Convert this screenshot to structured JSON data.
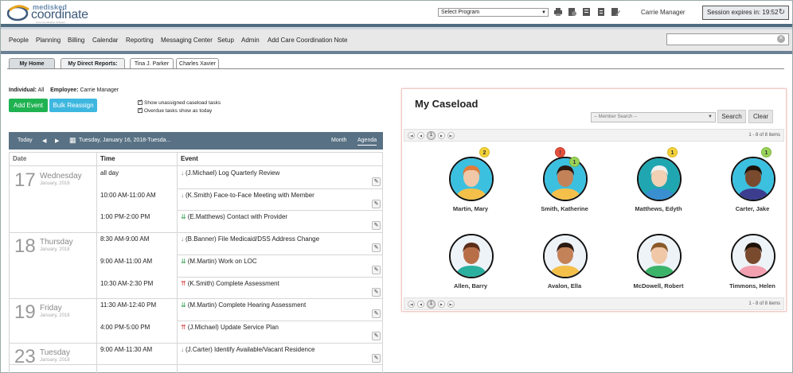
{
  "header": {
    "logo_top": "medisked",
    "logo_main": "coordinate",
    "logo_tagline": "Care Coordination Software",
    "program_select": "Select Program",
    "icons": [
      "print-icon",
      "print-preview-icon",
      "list-icon",
      "document-icon",
      "edit-document-icon"
    ],
    "user": "Carrie Manager",
    "session": "Session expires in: 19:52"
  },
  "nav": {
    "items": [
      "People",
      "Planning",
      "Billing",
      "Calendar",
      "Reporting",
      "Messaging Center",
      "Setup",
      "Admin",
      "Add Care Coordination Note"
    ],
    "search_placeholder": ""
  },
  "tabs": {
    "home": "My Home",
    "reports": "My Direct Reports:",
    "people": [
      "Tina J. Parker",
      "Charles Xavier"
    ]
  },
  "filters": {
    "individual_label": "Individual:",
    "individual_value": "All",
    "employee_label": "Employee:",
    "employee_value": "Carrie Manager",
    "add_event": "Add Event",
    "bulk_reassign": "Bulk Reassign",
    "show_unassigned": "Show unassigned caseload tasks",
    "overdue_today": "Overdue tasks show as today"
  },
  "calendar": {
    "today": "Today",
    "date_label": "Tuesday, January 16, 2018-Tuesda...",
    "view_month": "Month",
    "view_agenda": "Agenda",
    "headers": [
      "Date",
      "Time",
      "Event"
    ],
    "days": [
      {
        "num": "17",
        "day": "Wednesday",
        "month": "January, 2018",
        "events": [
          {
            "time": "all day",
            "arrow": "↓",
            "arrow_class": "arr-grey",
            "text": "(J.Michael) Log Quarterly Review"
          },
          {
            "time": "10:00 AM-11:00 AM",
            "arrow": "↓",
            "arrow_class": "arr-grey",
            "text": "(K.Smith) Face-to-Face Meeting with Member"
          },
          {
            "time": "1:00 PM-2:00 PM",
            "arrow": "⇊",
            "arrow_class": "arr-green",
            "text": "(E.Matthews) Contact with Provider"
          }
        ]
      },
      {
        "num": "18",
        "day": "Thursday",
        "month": "January, 2018",
        "events": [
          {
            "time": "8:30 AM-9:00 AM",
            "arrow": "↓",
            "arrow_class": "arr-grey",
            "text": "(B.Banner) File Medicaid/DSS Address Change"
          },
          {
            "time": "9:00 AM-11:00 AM",
            "arrow": "⇊",
            "arrow_class": "arr-green",
            "text": "(M.Martin) Work on LOC"
          },
          {
            "time": "10:30 AM-2:30 PM",
            "arrow": "⇈",
            "arrow_class": "arr-red",
            "text": "(K.Smith) Complete Assessment"
          }
        ]
      },
      {
        "num": "19",
        "day": "Friday",
        "month": "January, 2018",
        "events": [
          {
            "time": "11:30 AM-12:40 PM",
            "arrow": "⇊",
            "arrow_class": "arr-green",
            "text": "(M.Martin) Complete Hearing Assessment"
          },
          {
            "time": "4:00 PM-5:00 PM",
            "arrow": "⇈",
            "arrow_class": "arr-red",
            "text": "(J.Michael) Update Service Plan"
          }
        ]
      },
      {
        "num": "23",
        "day": "Tuesday",
        "month": "January, 2018",
        "events": [
          {
            "time": "9:00 AM-11:30 AM",
            "arrow": "↓",
            "arrow_class": "arr-grey",
            "text": "(J.Carter) Identify Available/Vacant Residence"
          }
        ]
      }
    ]
  },
  "caseload": {
    "title": "My Caseload",
    "member_search": "-- Member Search --",
    "search": "Search",
    "clear": "Clear",
    "page": "1",
    "page_info": "1 - 8 of 8 items",
    "members": [
      {
        "name": "Martin, Mary",
        "skin": "#f0c8a8",
        "hair": "#e07b3a",
        "bg": "#3cc0e0",
        "shirt": "#f4c04a"
      },
      {
        "name": "Smith, Katherine",
        "skin": "#c48258",
        "hair": "#2b1a12",
        "bg": "#3cc0e0",
        "shirt": "#f4c04a"
      },
      {
        "name": "Matthews, Edyth",
        "skin": "#f2d0b4",
        "hair": "#f0f0f0",
        "bg": "#20a6b0",
        "shirt": "#3a8fd0"
      },
      {
        "name": "Carter, Jake",
        "skin": "#7a4a2e",
        "hair": "#1d1208",
        "bg": "#3cc0e0",
        "shirt": "#3d3d8f"
      },
      {
        "name": "Allen, Barry",
        "skin": "#b86f48",
        "hair": "#5a2e18",
        "bg": "#eef3f8",
        "shirt": "#2bb0a0"
      },
      {
        "name": "Avalon, Ella",
        "skin": "#c48258",
        "hair": "#2b1a12",
        "bg": "#eef3f8",
        "shirt": "#f4c04a"
      },
      {
        "name": "McDowell, Robert",
        "skin": "#f0c8a8",
        "hair": "#8a5a2a",
        "bg": "#eef3f8",
        "shirt": "#3bb46a"
      },
      {
        "name": "Timmons, Helen",
        "skin": "#7a4a2e",
        "hair": "#1d1208",
        "bg": "#eef3f8",
        "shirt": "#f3a0b0"
      }
    ],
    "badges": [
      {
        "member": 0,
        "value": "2",
        "kind": "b-yellow"
      },
      {
        "member": 1,
        "value": "!",
        "kind": "b-red"
      },
      {
        "member": 1,
        "value": "1",
        "kind": "b-green"
      },
      {
        "member": 2,
        "value": "1",
        "kind": "b-yellow"
      },
      {
        "member": 3,
        "value": "1",
        "kind": "b-green"
      }
    ]
  }
}
